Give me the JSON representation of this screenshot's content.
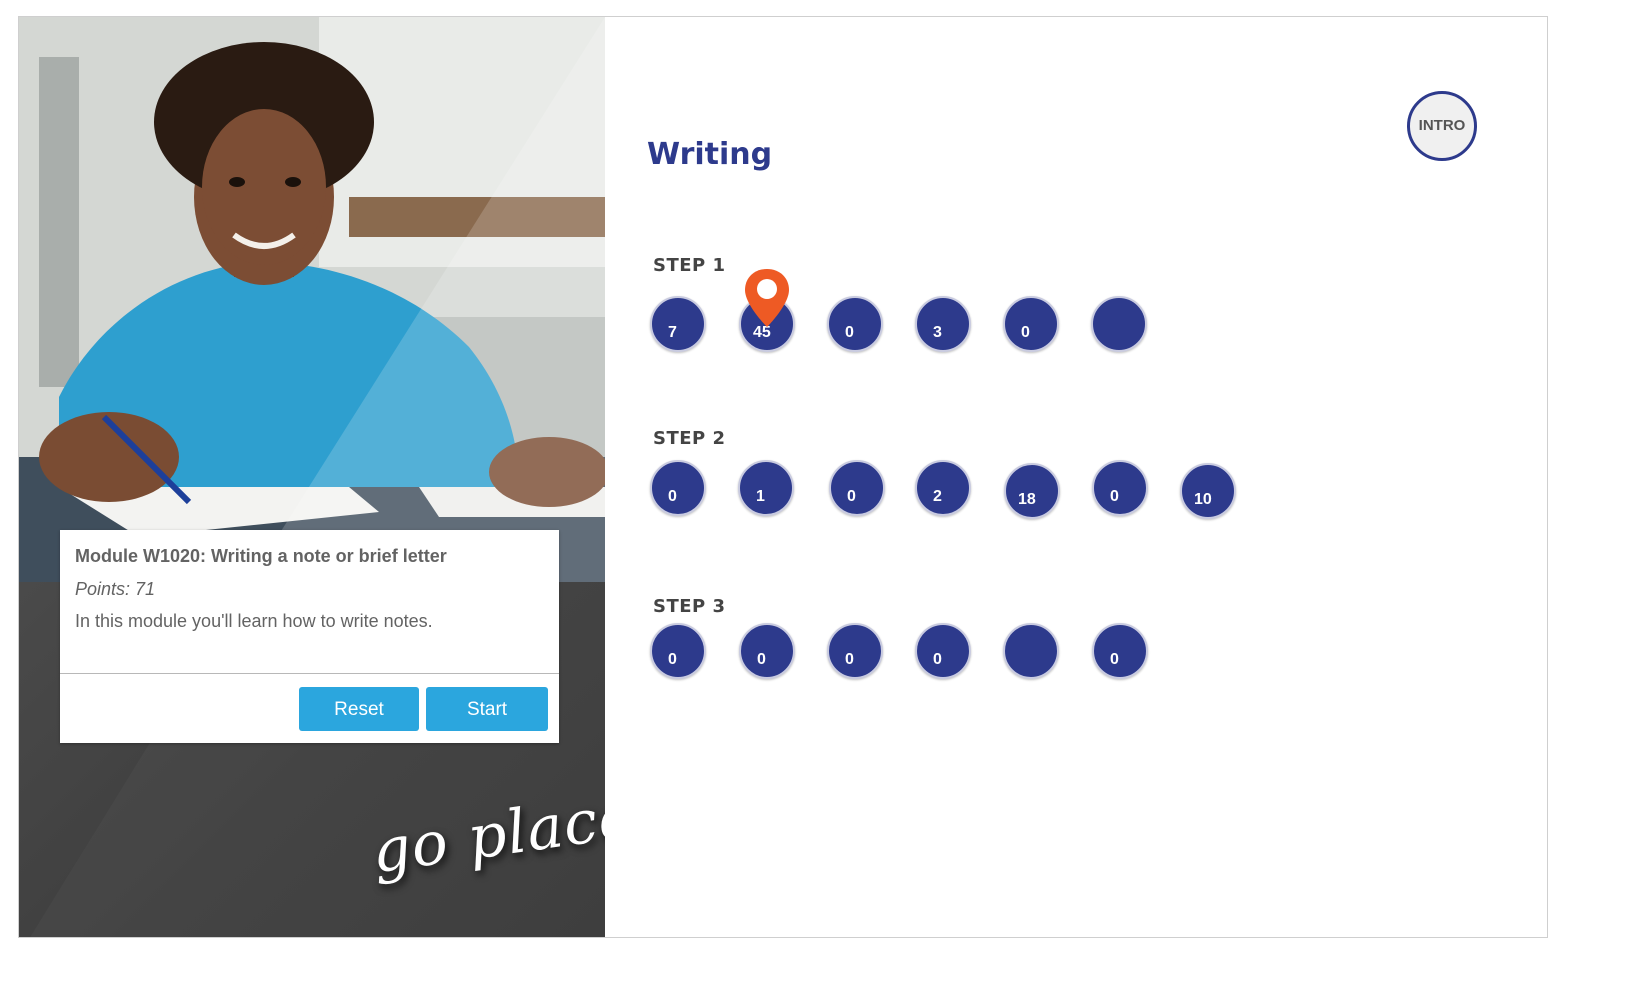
{
  "module": {
    "title": "Module W1020: Writing a note or brief letter",
    "points": "Points: 71",
    "description": "In this module you'll learn how to write notes.",
    "reset_label": "Reset",
    "start_label": "Start"
  },
  "brand": {
    "tagline": "go places"
  },
  "page": {
    "title": "Writing",
    "intro_label": "INTRO"
  },
  "steps": [
    {
      "label": "STEP 1",
      "nodes": [
        "7",
        "45",
        "0",
        "3",
        "0",
        ""
      ]
    },
    {
      "label": "STEP 2",
      "nodes": [
        "0",
        "1",
        "0",
        "2",
        "18",
        "0",
        "10"
      ]
    },
    {
      "label": "STEP 3",
      "nodes": [
        "0",
        "0",
        "0",
        "0",
        "",
        "0"
      ]
    }
  ],
  "colors": {
    "accent": "#2d3a8c",
    "button": "#2ba6de",
    "marker": "#ee5a24"
  },
  "icons": {
    "current_position": "map-pin-icon"
  }
}
